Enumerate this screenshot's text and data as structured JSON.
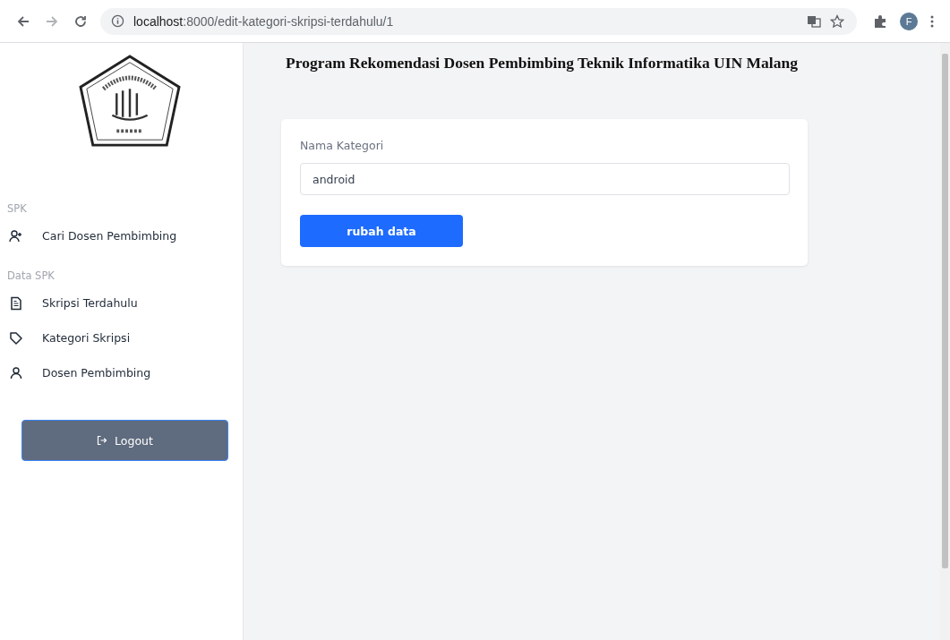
{
  "browser": {
    "url_host": "localhost",
    "url_path": ":8000/edit-kategori-skripsi-terdahulu/1",
    "profile_initial": "F"
  },
  "sidebar": {
    "sections": [
      {
        "heading": "SPK",
        "items": [
          {
            "label": "Cari Dosen Pembimbing",
            "kind": "user-plus"
          }
        ]
      },
      {
        "heading": "Data SPK",
        "items": [
          {
            "label": "Skripsi Terdahulu",
            "kind": "document"
          },
          {
            "label": "Kategori Skripsi",
            "kind": "tag"
          },
          {
            "label": "Dosen Pembimbing",
            "kind": "user"
          }
        ]
      }
    ],
    "logout": "Logout"
  },
  "page_title": "Program Rekomendasi Dosen Pembimbing Teknik Informatika UIN Malang",
  "form": {
    "label": "Nama Kategori",
    "value": "android",
    "submit": "rubah data"
  }
}
